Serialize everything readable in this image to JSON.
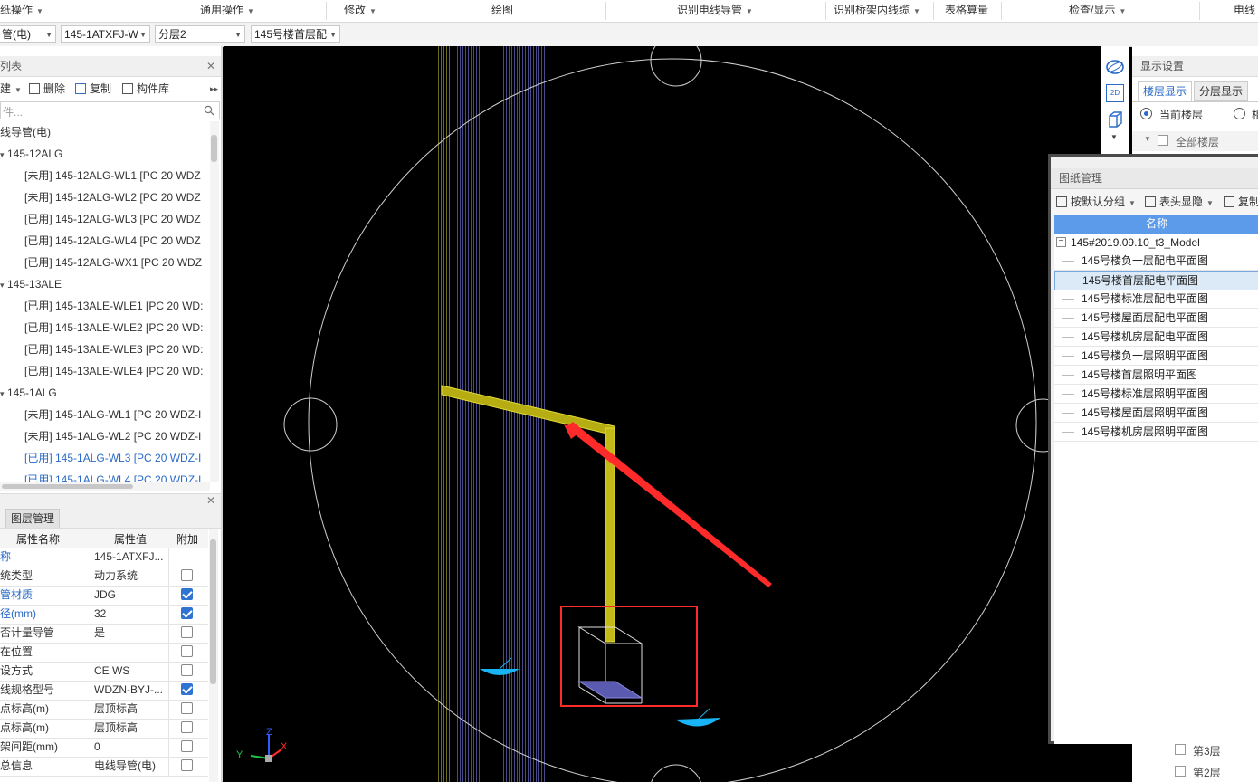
{
  "menubar": {
    "items": [
      "纸操作",
      "通用操作",
      "修改",
      "绘图",
      "识别电线导管",
      "识别桥架内线缆",
      "表格算量",
      "检查/显示",
      "电线"
    ]
  },
  "dropbar": {
    "selects": [
      "管(电)",
      "145-1ATXFJ-W",
      "分层2",
      "145号楼首层配"
    ]
  },
  "left_list": {
    "title": "列表",
    "toolbar": {
      "new": "建",
      "delete": "删除",
      "copy": "复制",
      "library": "构件库"
    },
    "search_placeholder": "件...",
    "tree": [
      {
        "label": "线导管(电)",
        "indent": 0,
        "blue": false
      },
      {
        "label": "145-12ALG",
        "indent": 1,
        "blue": false,
        "group": true
      },
      {
        "label": "[未用] 145-12ALG-WL1 [PC 20 WDZ",
        "indent": 2,
        "blue": false
      },
      {
        "label": "[未用] 145-12ALG-WL2 [PC 20 WDZ",
        "indent": 2,
        "blue": false
      },
      {
        "label": "[已用] 145-12ALG-WL3 [PC 20 WDZ",
        "indent": 2,
        "blue": false
      },
      {
        "label": "[已用] 145-12ALG-WL4 [PC 20 WDZ",
        "indent": 2,
        "blue": false
      },
      {
        "label": "[已用] 145-12ALG-WX1 [PC 20 WDZ",
        "indent": 2,
        "blue": false
      },
      {
        "label": "145-13ALE",
        "indent": 1,
        "blue": false,
        "group": true
      },
      {
        "label": "[已用] 145-13ALE-WLE1 [PC 20 WD:",
        "indent": 2,
        "blue": false
      },
      {
        "label": "[已用] 145-13ALE-WLE2 [PC 20 WD:",
        "indent": 2,
        "blue": false
      },
      {
        "label": "[已用] 145-13ALE-WLE3 [PC 20 WD:",
        "indent": 2,
        "blue": false
      },
      {
        "label": "[已用] 145-13ALE-WLE4 [PC 20 WD:",
        "indent": 2,
        "blue": false
      },
      {
        "label": "145-1ALG",
        "indent": 1,
        "blue": false,
        "group": true
      },
      {
        "label": "[未用] 145-1ALG-WL1 [PC 20 WDZ-I",
        "indent": 2,
        "blue": false
      },
      {
        "label": "[未用] 145-1ALG-WL2 [PC 20 WDZ-I",
        "indent": 2,
        "blue": false
      },
      {
        "label": "[已用] 145-1ALG-WL3 [PC 20 WDZ-I",
        "indent": 2,
        "blue": true
      },
      {
        "label": "[已用] 145-1ALG-WL4 [PC 20 WDZ-I",
        "indent": 2,
        "blue": true
      }
    ]
  },
  "properties": {
    "tab": "图层管理",
    "headers": [
      "属性名称",
      "属性值",
      "附加"
    ],
    "rows": [
      {
        "name": "称",
        "value": "145-1ATXFJ...",
        "blue": true,
        "check": null
      },
      {
        "name": "统类型",
        "value": "动力系统",
        "blue": false,
        "check": false
      },
      {
        "name": "管材质",
        "value": "JDG",
        "blue": true,
        "check": true
      },
      {
        "name": "径(mm)",
        "value": "32",
        "blue": true,
        "check": true
      },
      {
        "name": "否计量导管",
        "value": "是",
        "blue": false,
        "check": false
      },
      {
        "name": "在位置",
        "value": "",
        "blue": false,
        "check": false
      },
      {
        "name": "设方式",
        "value": "CE WS",
        "blue": false,
        "check": false
      },
      {
        "name": "线规格型号",
        "value": "WDZN-BYJ-...",
        "blue": false,
        "check": true
      },
      {
        "name": "点标高(m)",
        "value": "层顶标高",
        "blue": false,
        "check": false
      },
      {
        "name": "点标高(m)",
        "value": "层顶标高",
        "blue": false,
        "check": false
      },
      {
        "name": "架间距(mm)",
        "value": "0",
        "blue": false,
        "check": false
      },
      {
        "name": "总信息",
        "value": "电线导管(电)",
        "blue": false,
        "check": false
      }
    ]
  },
  "toolbox": {
    "icons": [
      "dynamic-observe-icon",
      "2d-view-icon",
      "3d-box-icon"
    ],
    "view2d_label": "2D"
  },
  "display_settings": {
    "title": "显示设置",
    "tabs": [
      "楼层显示",
      "分层显示"
    ],
    "radio_current": "当前楼层",
    "radio_other": "相",
    "all_floors": "全部楼层",
    "floor_rows": [
      "第3层",
      "第2层"
    ]
  },
  "drawing_manager": {
    "title": "图纸管理",
    "toolbar": {
      "group": "按默认分组",
      "header": "表头显隐",
      "copy": "复制"
    },
    "column": "名称",
    "root": "145#2019.09.10_t3_Model",
    "items": [
      {
        "label": "145号楼负一层配电平面图",
        "selected": false
      },
      {
        "label": "145号楼首层配电平面图",
        "selected": true
      },
      {
        "label": "145号楼标准层配电平面图",
        "selected": false
      },
      {
        "label": "145号楼屋面层配电平面图",
        "selected": false
      },
      {
        "label": "145号楼机房层配电平面图",
        "selected": false
      },
      {
        "label": "145号楼负一层照明平面图",
        "selected": false
      },
      {
        "label": "145号楼首层照明平面图",
        "selected": false
      },
      {
        "label": "145号楼标准层照明平面图",
        "selected": false
      },
      {
        "label": "145号楼屋面层照明平面图",
        "selected": false
      },
      {
        "label": "145号楼机房层照明平面图",
        "selected": false
      }
    ]
  },
  "viewport": {
    "axes": {
      "x": "X",
      "y": "Y",
      "z": "Z"
    },
    "colors": {
      "conduit": "#d4cc1a",
      "highlight": "#ff2a2a",
      "circle": "#cfcfcf",
      "fixture": "#1ab8ff"
    }
  }
}
